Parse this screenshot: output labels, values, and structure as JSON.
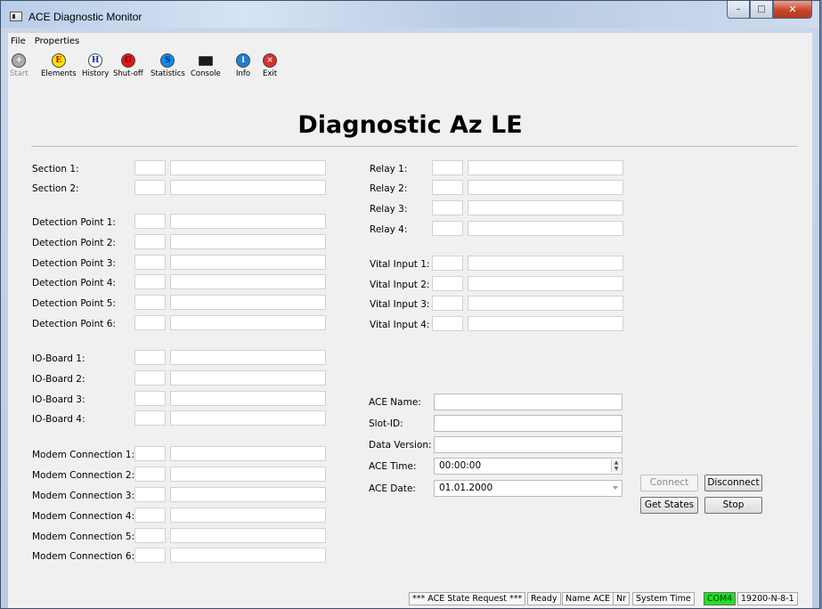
{
  "window": {
    "title": "ACE Diagnostic Monitor",
    "min_glyph": "–",
    "max_glyph": "□",
    "close_glyph": "✕"
  },
  "menu": [
    "File",
    "Properties"
  ],
  "toolbar": [
    {
      "label": "Start",
      "icon": "add-icon",
      "glyph": "+",
      "fill": "#a9a9a9",
      "fg": "#fff",
      "disabled": true
    },
    {
      "label": "Elements",
      "icon": "elements-icon",
      "glyph": "E",
      "fill": "#ffe100",
      "fg": "#b30000"
    },
    {
      "label": "History",
      "icon": "history-icon",
      "glyph": "H",
      "fill": "#ffffff",
      "fg": "#0a2fb0"
    },
    {
      "label": "Shut-off",
      "icon": "shutoff-icon",
      "glyph": "G",
      "fill": "#e0161b",
      "fg": "#6b0000"
    },
    {
      "label": "Statistics",
      "icon": "statistics-icon",
      "glyph": "S",
      "fill": "#0f8bea",
      "fg": "#002a7a"
    },
    {
      "label": "Console",
      "icon": "console-icon",
      "glyph": "",
      "fill": "#1a1a1a",
      "fg": "#fff"
    },
    {
      "label": "Info",
      "icon": "info-icon",
      "glyph": "i",
      "fill": "#1f7fd6",
      "fg": "#fff"
    },
    {
      "label": "Exit",
      "icon": "exit-icon",
      "glyph": "×",
      "fill": "#d6322a",
      "fg": "#fff"
    }
  ],
  "heading": "Diagnostic Az LE",
  "left_labels": {
    "sections": [
      "Section 1:",
      "Section 2:"
    ],
    "detection": [
      "Detection Point 1:",
      "Detection Point 2:",
      "Detection Point 3:",
      "Detection Point 4:",
      "Detection Point 5:",
      "Detection Point 6:"
    ],
    "ioboards": [
      "IO-Board 1:",
      "IO-Board 2:",
      "IO-Board 3:",
      "IO-Board 4:"
    ],
    "modems": [
      "Modem Connection 1:",
      "Modem Connection 2:",
      "Modem Connection 3:",
      "Modem Connection 4:",
      "Modem Connection 5:",
      "Modem Connection 6:"
    ]
  },
  "right_labels": {
    "relays": [
      "Relay 1:",
      "Relay 2:",
      "Relay 3:",
      "Relay 4:"
    ],
    "vital_inputs": [
      "Vital Input 1:",
      "Vital Input 2:",
      "Vital Input 3:",
      "Vital Input 4:"
    ]
  },
  "ace_info": {
    "name_label": "ACE Name:",
    "name_value": "",
    "slot_label": "Slot-ID:",
    "slot_value": "",
    "version_label": "Data Version:",
    "version_value": "",
    "time_label": "ACE Time:",
    "time_value": "00:00:00",
    "date_label": "ACE Date:",
    "date_value": "01.01.2000"
  },
  "buttons": {
    "connect": "Connect",
    "disconnect": "Disconnect",
    "get_states": "Get States",
    "stop": "Stop"
  },
  "status": [
    "*** ACE State Request ***",
    "Ready",
    "Name ACE",
    "Nr",
    "System Time",
    "COM4",
    "19200-N-8-1"
  ]
}
